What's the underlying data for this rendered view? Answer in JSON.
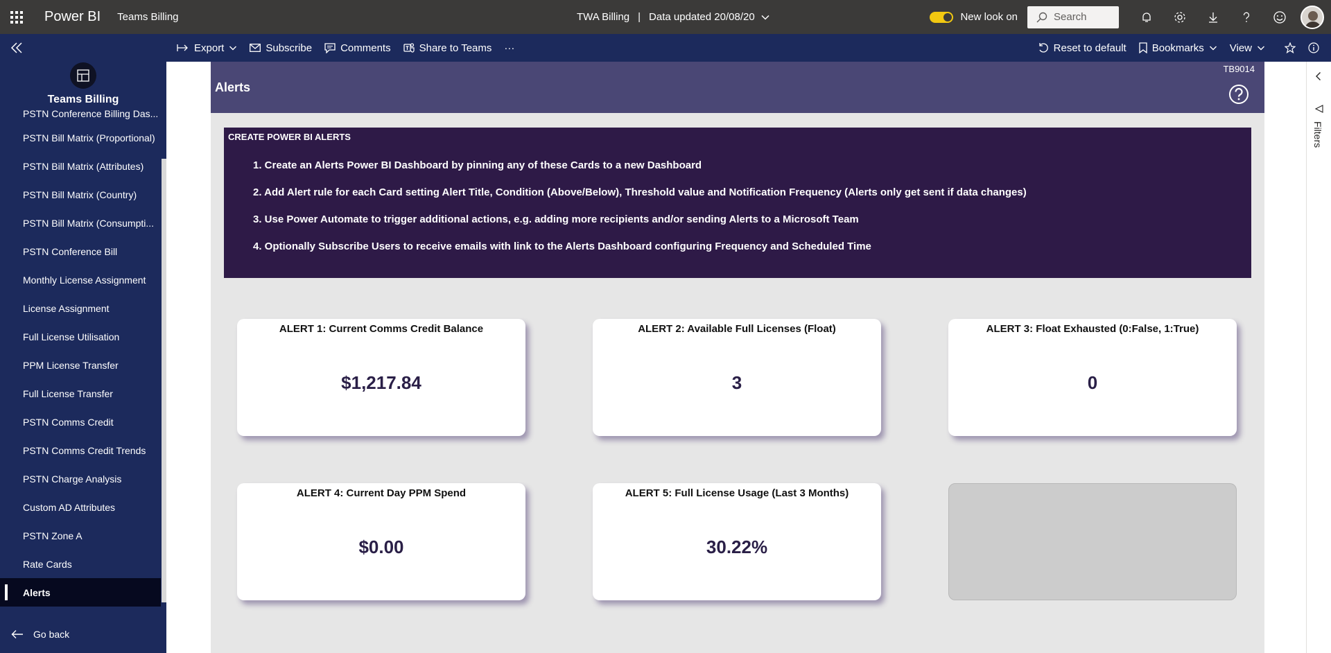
{
  "topbar": {
    "brand": "Power BI",
    "workspace": "Teams Billing",
    "report_name": "TWA Billing",
    "separator": "|",
    "data_updated": "Data updated 20/08/20",
    "new_look_label": "New look on",
    "search_placeholder": "Search"
  },
  "actionbar": {
    "export": "Export",
    "subscribe": "Subscribe",
    "comments": "Comments",
    "share_to_teams": "Share to Teams",
    "more": "···",
    "reset_to_default": "Reset to default",
    "bookmarks": "Bookmarks",
    "view": "View"
  },
  "sidebar": {
    "title": "Teams Billing",
    "items": [
      {
        "label": "PSTN Conference Billing Das..."
      },
      {
        "label": "PSTN Bill Matrix (Proportional)"
      },
      {
        "label": "PSTN Bill Matrix (Attributes)"
      },
      {
        "label": "PSTN Bill Matrix (Country)"
      },
      {
        "label": "PSTN Bill Matrix (Consumpti..."
      },
      {
        "label": "PSTN Conference Bill"
      },
      {
        "label": "Monthly License Assignment"
      },
      {
        "label": "License Assignment"
      },
      {
        "label": "Full License Utilisation"
      },
      {
        "label": "PPM License Transfer"
      },
      {
        "label": "Full License Transfer"
      },
      {
        "label": "PSTN Comms Credit"
      },
      {
        "label": "PSTN Comms Credit Trends"
      },
      {
        "label": "PSTN Charge Analysis"
      },
      {
        "label": "Custom AD Attributes"
      },
      {
        "label": "PSTN Zone A"
      },
      {
        "label": "Rate Cards"
      },
      {
        "label": "Alerts"
      }
    ],
    "active_item": "Alerts",
    "go_back": "Go back"
  },
  "report": {
    "title": "Alerts",
    "code": "TB9014",
    "info_title": "CREATE POWER  BI ALERTS",
    "steps": [
      "1. Create an Alerts Power BI Dashboard by pinning any of these Cards to a new Dashboard",
      "2. Add Alert rule for each Card setting Alert Title, Condition (Above/Below), Threshold value and Notification Frequency (Alerts only get sent if data changes)",
      "3. Use Power Automate to trigger additional actions, e.g. adding more recipients and/or sending Alerts to a Microsoft Team",
      "4. Optionally Subscribe Users to receive emails with link to the Alerts Dashboard configuring Frequency and Scheduled Time"
    ],
    "cards": [
      {
        "title": "ALERT 1: Current Comms Credit Balance",
        "value": "$1,217.84"
      },
      {
        "title": "ALERT 2: Available Full Licenses (Float)",
        "value": "3"
      },
      {
        "title": "ALERT 3: Float Exhausted (0:False, 1:True)",
        "value": "0"
      },
      {
        "title": "ALERT 4: Current Day PPM Spend",
        "value": "$0.00"
      },
      {
        "title": "ALERT 5: Full License Usage (Last 3 Months)",
        "value": "30.22%"
      }
    ]
  },
  "filters": {
    "label": "Filters"
  },
  "colors": {
    "topbar": "#3b3a39",
    "navy": "#1c2a5c",
    "header_purple": "#4a4775",
    "info_purple": "#2e1a47",
    "value_text": "#2a1f47",
    "toggle_on": "#f2c811"
  }
}
